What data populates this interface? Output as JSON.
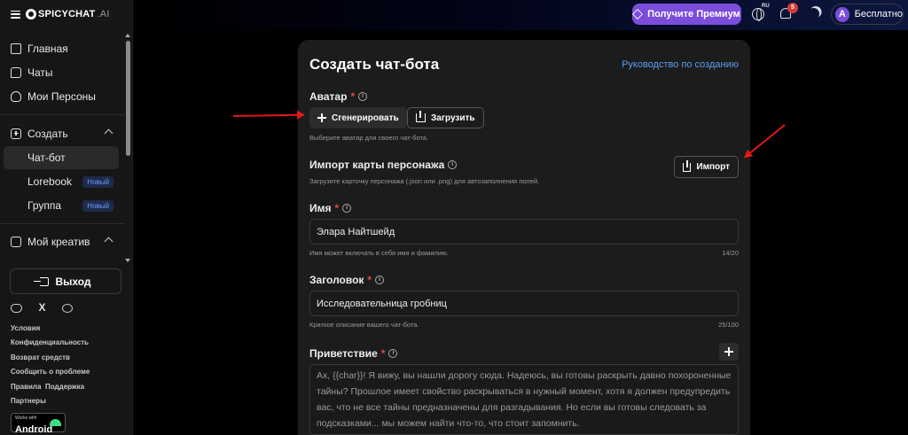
{
  "app": {
    "brand_main": "SPICYCHAT",
    "brand_sub": ".AI"
  },
  "header": {
    "premium_label": "Получите Премиум",
    "language_tag": "RU",
    "notification_count": "5",
    "account_initial": "A",
    "account_label": "Бесплатно"
  },
  "sidebar": {
    "items": [
      {
        "label": "Главная"
      },
      {
        "label": "Чаты"
      },
      {
        "label": "Мои Персоны"
      },
      {
        "label": "Создать"
      },
      {
        "label": "Чат-бот"
      },
      {
        "label": "Lorebook",
        "badge": "Новый"
      },
      {
        "label": "Группа",
        "badge": "Новый"
      },
      {
        "label": "Мой креатив"
      }
    ],
    "logout_label": "Выход",
    "social": {
      "x_glyph": "X"
    },
    "footer_links": [
      "Условия",
      "Конфиденциальность",
      "Возврат средств",
      "Сообщить о проблеме",
      "Правила",
      "Поддержка",
      "Партнеры"
    ],
    "android_badge": {
      "small": "Works with",
      "big": "Android"
    }
  },
  "form": {
    "title": "Создать чат-бота",
    "guide_link": "Руководство по созданию",
    "avatar": {
      "label": "Аватар",
      "required_mark": "*",
      "generate_label": "Сгенерировать",
      "upload_label": "Загрузить",
      "hint": "Выберите аватар для своего чат-бота."
    },
    "import": {
      "label": "Импорт карты персонажа",
      "hint": "Загрузите карточку персонажа (.json или .png) для автозаполнения полей.",
      "button_label": "Импорт"
    },
    "name": {
      "label": "Имя",
      "required_mark": "*",
      "value": "Элара Найтшейд",
      "hint": "Имя может включать в себя имя и фамилию.",
      "counter": "14/20"
    },
    "headline": {
      "label": "Заголовок",
      "required_mark": "*",
      "value": "Исследовательница гробниц",
      "hint": "Краткое описание вашего чат-бота.",
      "counter": "25/100"
    },
    "greeting": {
      "label": "Приветствие",
      "required_mark": "*",
      "value": "Ах, {{char}}! Я вижу, вы нашли дорогу сюда. Надеюсь, вы готовы раскрыть давно похороненные тайны? Прошлое имеет свойство раскрываться в нужный момент, хотя я должен предупредить вас, что не все тайны предназначены для разгадывания. Но если вы готовы следовать за подсказками... мы можем найти что-то, что стоит запомнить."
    }
  },
  "colors": {
    "premium": "#7c4ddb",
    "link": "#5b9cf6",
    "required": "#e04b4b",
    "annotation_arrow": "#e01818"
  }
}
